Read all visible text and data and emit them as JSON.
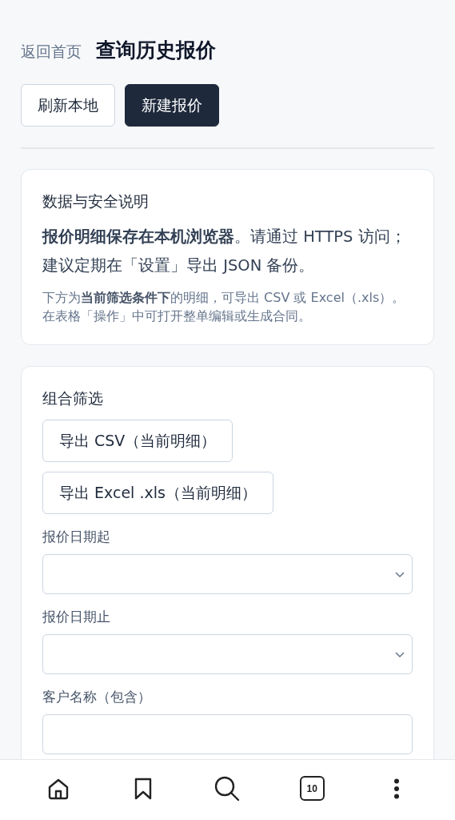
{
  "header": {
    "back_link": "返回首页",
    "title": "查询历史报价"
  },
  "actions": [
    {
      "label": "刷新本地",
      "kind": "secondary"
    },
    {
      "label": "新建报价",
      "kind": "primary"
    }
  ],
  "notice": {
    "title": "数据与安全说明",
    "body": "**报价明细保存在本机浏览器**。请通过 HTTPS 访问；建议定期在「设置」导出 JSON 备份。",
    "note": "下方为**当前筛选条件下**的明细，可导出 CSV 或 Excel（.xls）。在表格「操作」中可打开整单编辑或生成合同。"
  },
  "filters": {
    "title": "组合筛选",
    "export_buttons": [
      "导出 CSV（当前明细）",
      "导出 Excel .xls（当前明细）"
    ],
    "fields": [
      {
        "label": "报价日期起",
        "kind": "select"
      },
      {
        "label": "报价日期止",
        "kind": "select"
      },
      {
        "label": "客户名称（包含）",
        "kind": "text"
      }
    ]
  },
  "bottom_nav": [
    {
      "kind": "home"
    },
    {
      "kind": "bookmark"
    },
    {
      "kind": "search"
    },
    {
      "kind": "tabs",
      "count": "10"
    },
    {
      "kind": "more"
    }
  ]
}
